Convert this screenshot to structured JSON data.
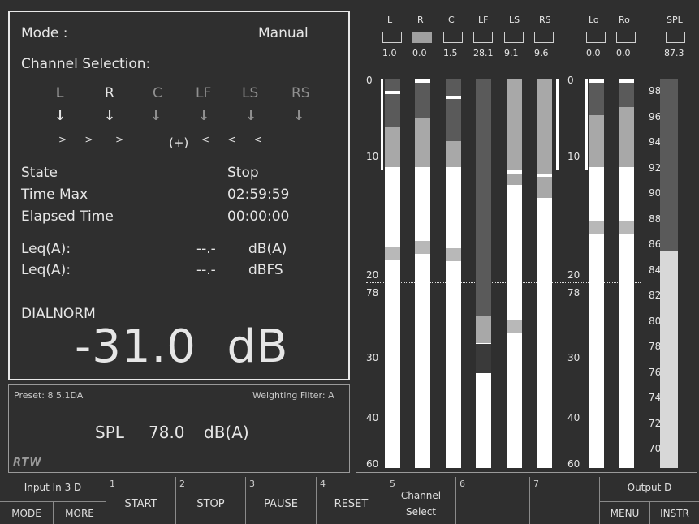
{
  "status": {
    "mode_label": "Mode :",
    "mode_value": "Manual",
    "channel_selection_label": "Channel Selection:",
    "channels": [
      {
        "name": "L",
        "active": true
      },
      {
        "name": "R",
        "active": true
      },
      {
        "name": "C",
        "active": false
      },
      {
        "name": "LF",
        "active": false
      },
      {
        "name": "LS",
        "active": false
      },
      {
        "name": "RS",
        "active": false
      }
    ],
    "sum_left": ">---->----->",
    "sum_plus": "(+)",
    "sum_right": "<----<----<",
    "state_label": "State",
    "state_value": "Stop",
    "time_max_label": "Time Max",
    "time_max_value": "02:59:59",
    "elapsed_label": "Elapsed Time",
    "elapsed_value": "00:00:00",
    "leq1_label": "Leq(A):",
    "leq1_value": "--.-",
    "leq1_unit": "dB(A)",
    "leq2_label": "Leq(A):",
    "leq2_value": "--.-",
    "leq2_unit": "dBFS",
    "dialnorm_label": "DIALNORM",
    "dialnorm_value": "-31.0  dB"
  },
  "lower": {
    "preset": "Preset: 8 5.1DA",
    "weighting": "Weighting Filter: A",
    "spl_label": "SPL",
    "spl_value": "78.0",
    "spl_unit": "dB(A)",
    "logo": "RTW"
  },
  "meters": {
    "channels": [
      {
        "name": "L",
        "value": "1.0",
        "lit": false
      },
      {
        "name": "R",
        "value": "0.0",
        "lit": true
      },
      {
        "name": "C",
        "value": "1.5",
        "lit": false
      },
      {
        "name": "LF",
        "value": "28.1",
        "lit": false
      },
      {
        "name": "LS",
        "value": "9.1",
        "lit": false
      },
      {
        "name": "RS",
        "value": "9.6",
        "lit": false
      }
    ],
    "output_channels": [
      {
        "name": "Lo",
        "value": "0.0"
      },
      {
        "name": "Ro",
        "value": "0.0"
      }
    ],
    "spl": {
      "name": "SPL",
      "value": "87.3"
    },
    "left_scale": [
      "0",
      "10",
      "20",
      "78",
      "30",
      "40",
      "60"
    ],
    "right_scale": [
      "0",
      "10",
      "20",
      "78",
      "30",
      "40",
      "60"
    ],
    "spl_scale": [
      "98",
      "96",
      "94",
      "92",
      "90",
      "88",
      "86",
      "84",
      "82",
      "80",
      "78",
      "76",
      "74",
      "72",
      "70"
    ]
  },
  "softkeys": {
    "input_label": "Input In 3 D",
    "mode": "MODE",
    "more": "MORE",
    "keys": [
      {
        "num": "1",
        "label": "START"
      },
      {
        "num": "2",
        "label": "STOP"
      },
      {
        "num": "3",
        "label": "PAUSE"
      },
      {
        "num": "4",
        "label": "RESET"
      },
      {
        "num": "5",
        "label": "Channel",
        "label2": "Select"
      },
      {
        "num": "6",
        "label": ""
      },
      {
        "num": "7",
        "label": ""
      }
    ],
    "output_label": "Output D",
    "menu": "MENU",
    "instr": "INSTR"
  }
}
